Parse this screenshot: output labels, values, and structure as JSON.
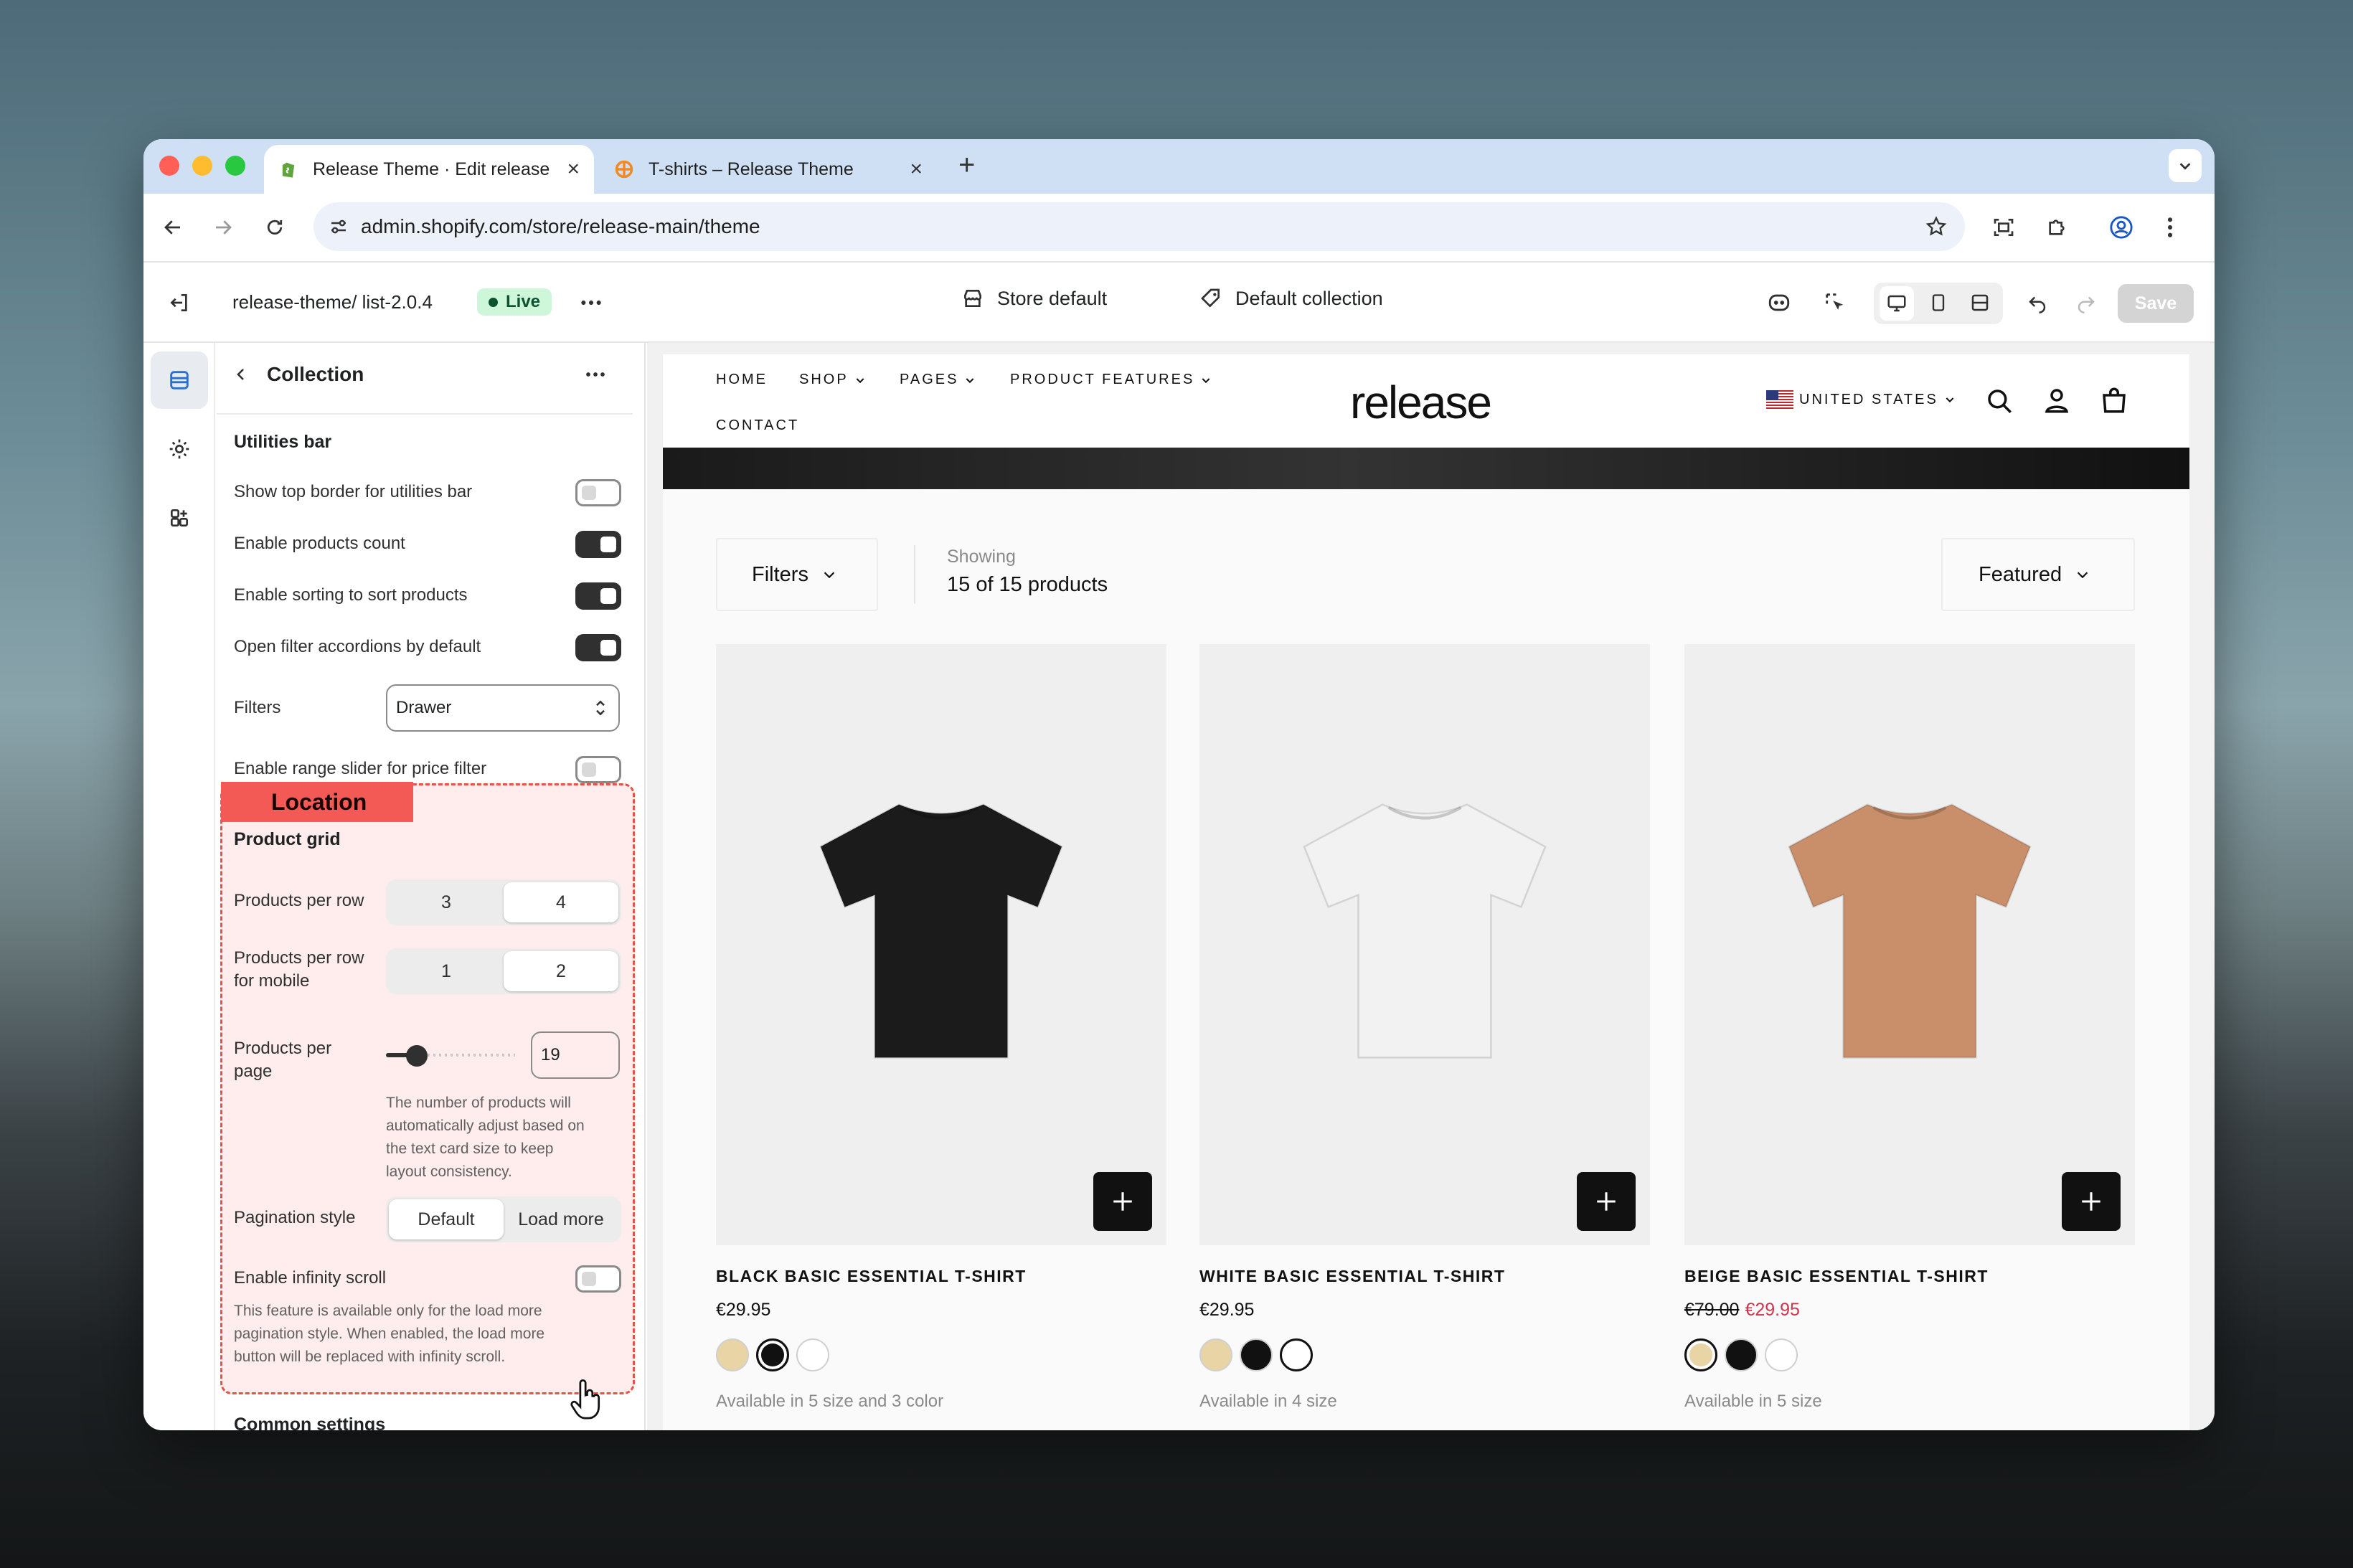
{
  "browser": {
    "tabs": [
      {
        "title": "Release Theme · Edit release-",
        "active": true
      },
      {
        "title": "T-shirts – Release Theme",
        "active": false
      }
    ],
    "url": "admin.shopify.com/store/release-main/theme"
  },
  "header": {
    "theme_path": "release-theme/ list-2.0.4",
    "live_badge": "Live",
    "store_selector": "Store default",
    "template_selector": "Default collection",
    "save_label": "Save"
  },
  "panel": {
    "title": "Collection",
    "utilities_heading": "Utilities bar",
    "settings": [
      {
        "label": "Show top border for utilities bar",
        "on": false
      },
      {
        "label": "Enable products count",
        "on": true
      },
      {
        "label": "Enable sorting to sort products",
        "on": true
      },
      {
        "label": "Open filter accordions by default",
        "on": true
      }
    ],
    "filters_label": "Filters",
    "filters_value": "Drawer",
    "range_slider_label": "Enable range slider for price filter",
    "range_slider_on": false,
    "location_tag": "Location",
    "product_grid_heading": "Product grid",
    "per_row_label": "Products per row",
    "per_row_options": [
      "3",
      "4"
    ],
    "per_row_selected": "4",
    "per_row_mobile_label_1": "Products per row",
    "per_row_mobile_label_2": "for mobile",
    "per_row_mobile_options": [
      "1",
      "2"
    ],
    "per_row_mobile_selected": "2",
    "per_page_label_1": "Products per",
    "per_page_label_2": "page",
    "per_page_value": "19",
    "per_page_help": [
      "The number of products will",
      "automatically adjust based on",
      "the text card size to keep",
      "layout consistency."
    ],
    "pagination_label": "Pagination style",
    "pagination_options": [
      "Default",
      "Load more"
    ],
    "pagination_selected": "Default",
    "infinity_label": "Enable infinity scroll",
    "infinity_on": false,
    "infinity_help": [
      "This feature is available only for the load more",
      "pagination style. When enabled, the load more",
      "button will be replaced with infinity scroll."
    ],
    "next_heading": "Common settings"
  },
  "store": {
    "nav": [
      "HOME",
      "SHOP",
      "PAGES",
      "PRODUCT FEATURES",
      "CONTACT"
    ],
    "logo": "release",
    "country": "UNITED STATES",
    "filters_button": "Filters",
    "showing_label": "Showing",
    "showing_count": "15 of 15 products",
    "sort_label": "Featured",
    "products": [
      {
        "name": "BLACK BASIC ESSENTIAL T-SHIRT",
        "price": "€29.95",
        "old_price": "",
        "availability": "Available in 5 size and 3 color",
        "shirt_color": "#1b1b1b",
        "active_swatch": 1
      },
      {
        "name": "WHITE BASIC ESSENTIAL T-SHIRT",
        "price": "€29.95",
        "old_price": "",
        "availability": "Available in 4 size",
        "shirt_color": "#f2f2f2",
        "active_swatch": 2
      },
      {
        "name": "BEIGE BASIC ESSENTIAL T-SHIRT",
        "price": "€29.95",
        "old_price": "€79.00",
        "availability": "Available in 5 size",
        "shirt_color": "#c98e6a",
        "active_swatch": 0
      }
    ],
    "swatch_colors": [
      "#e9d4a6",
      "#111111",
      "#ffffff"
    ]
  }
}
